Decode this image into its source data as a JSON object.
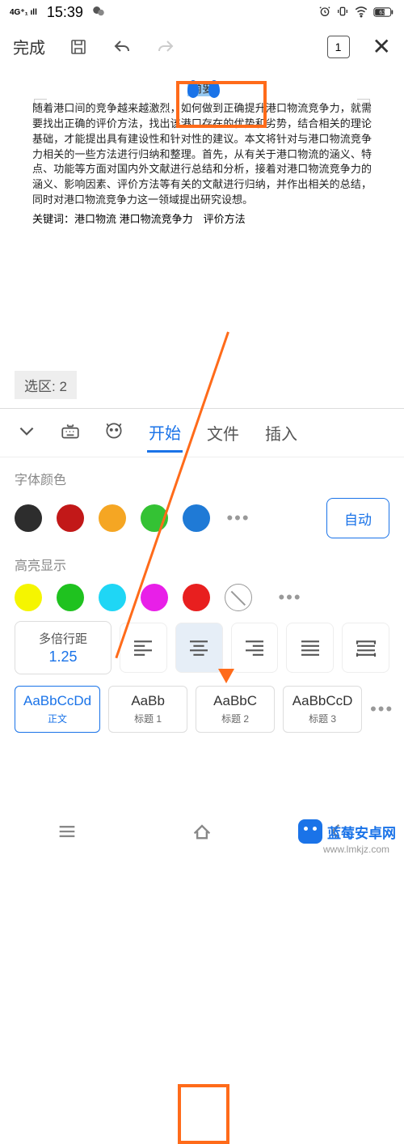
{
  "status": {
    "signal": "4G⁺₁ ıll",
    "time": "15:39",
    "battery": "63"
  },
  "toolbar": {
    "done": "完成",
    "page": "1"
  },
  "doc": {
    "title": "摘要",
    "body": "随着港口间的竞争越来越激烈，如何做到正确提升港口物流竞争力，就需要找出正确的评价方法，找出该港口存在的优势和劣势，结合相关的理论基础，才能提出具有建设性和针对性的建议。本文将针对与港口物流竞争力相关的一些方法进行归纳和整理。首先，从有关于港口物流的涵义、特点、功能等方面对国内外文献进行总结和分析，接着对港口物流竞争力的涵义、影响因素、评价方法等有关的文献进行归纳，并作出相关的总结，同时对港口物流竞争力这一领域提出研究设想。",
    "keywords": "关键词：港口物流 港口物流竞争力　评价方法"
  },
  "selection": {
    "label": "选区:",
    "count": "2"
  },
  "tabs": {
    "start": "开始",
    "file": "文件",
    "insert": "插入"
  },
  "fontColor": {
    "title": "字体颜色",
    "colors": [
      "#2d2d2d",
      "#c21818",
      "#f5a623",
      "#34c234",
      "#1f7ad6"
    ],
    "auto": "自动"
  },
  "highlight": {
    "title": "高亮显示",
    "colors": [
      "#f5f500",
      "#1fc21f",
      "#1fd6f5",
      "#e81fe8",
      "#e81f1f"
    ]
  },
  "lineSpacing": {
    "label": "多倍行距",
    "value": "1.25"
  },
  "styles": [
    {
      "prev": "AaBbCcDd",
      "name": "正文"
    },
    {
      "prev": "AaBb",
      "name": "标题 1"
    },
    {
      "prev": "AaBbC",
      "name": "标题 2"
    },
    {
      "prev": "AaBbCcD",
      "name": "标题 3"
    }
  ],
  "watermark": {
    "text": "蓝莓安卓网",
    "url": "www.lmkjz.com"
  }
}
